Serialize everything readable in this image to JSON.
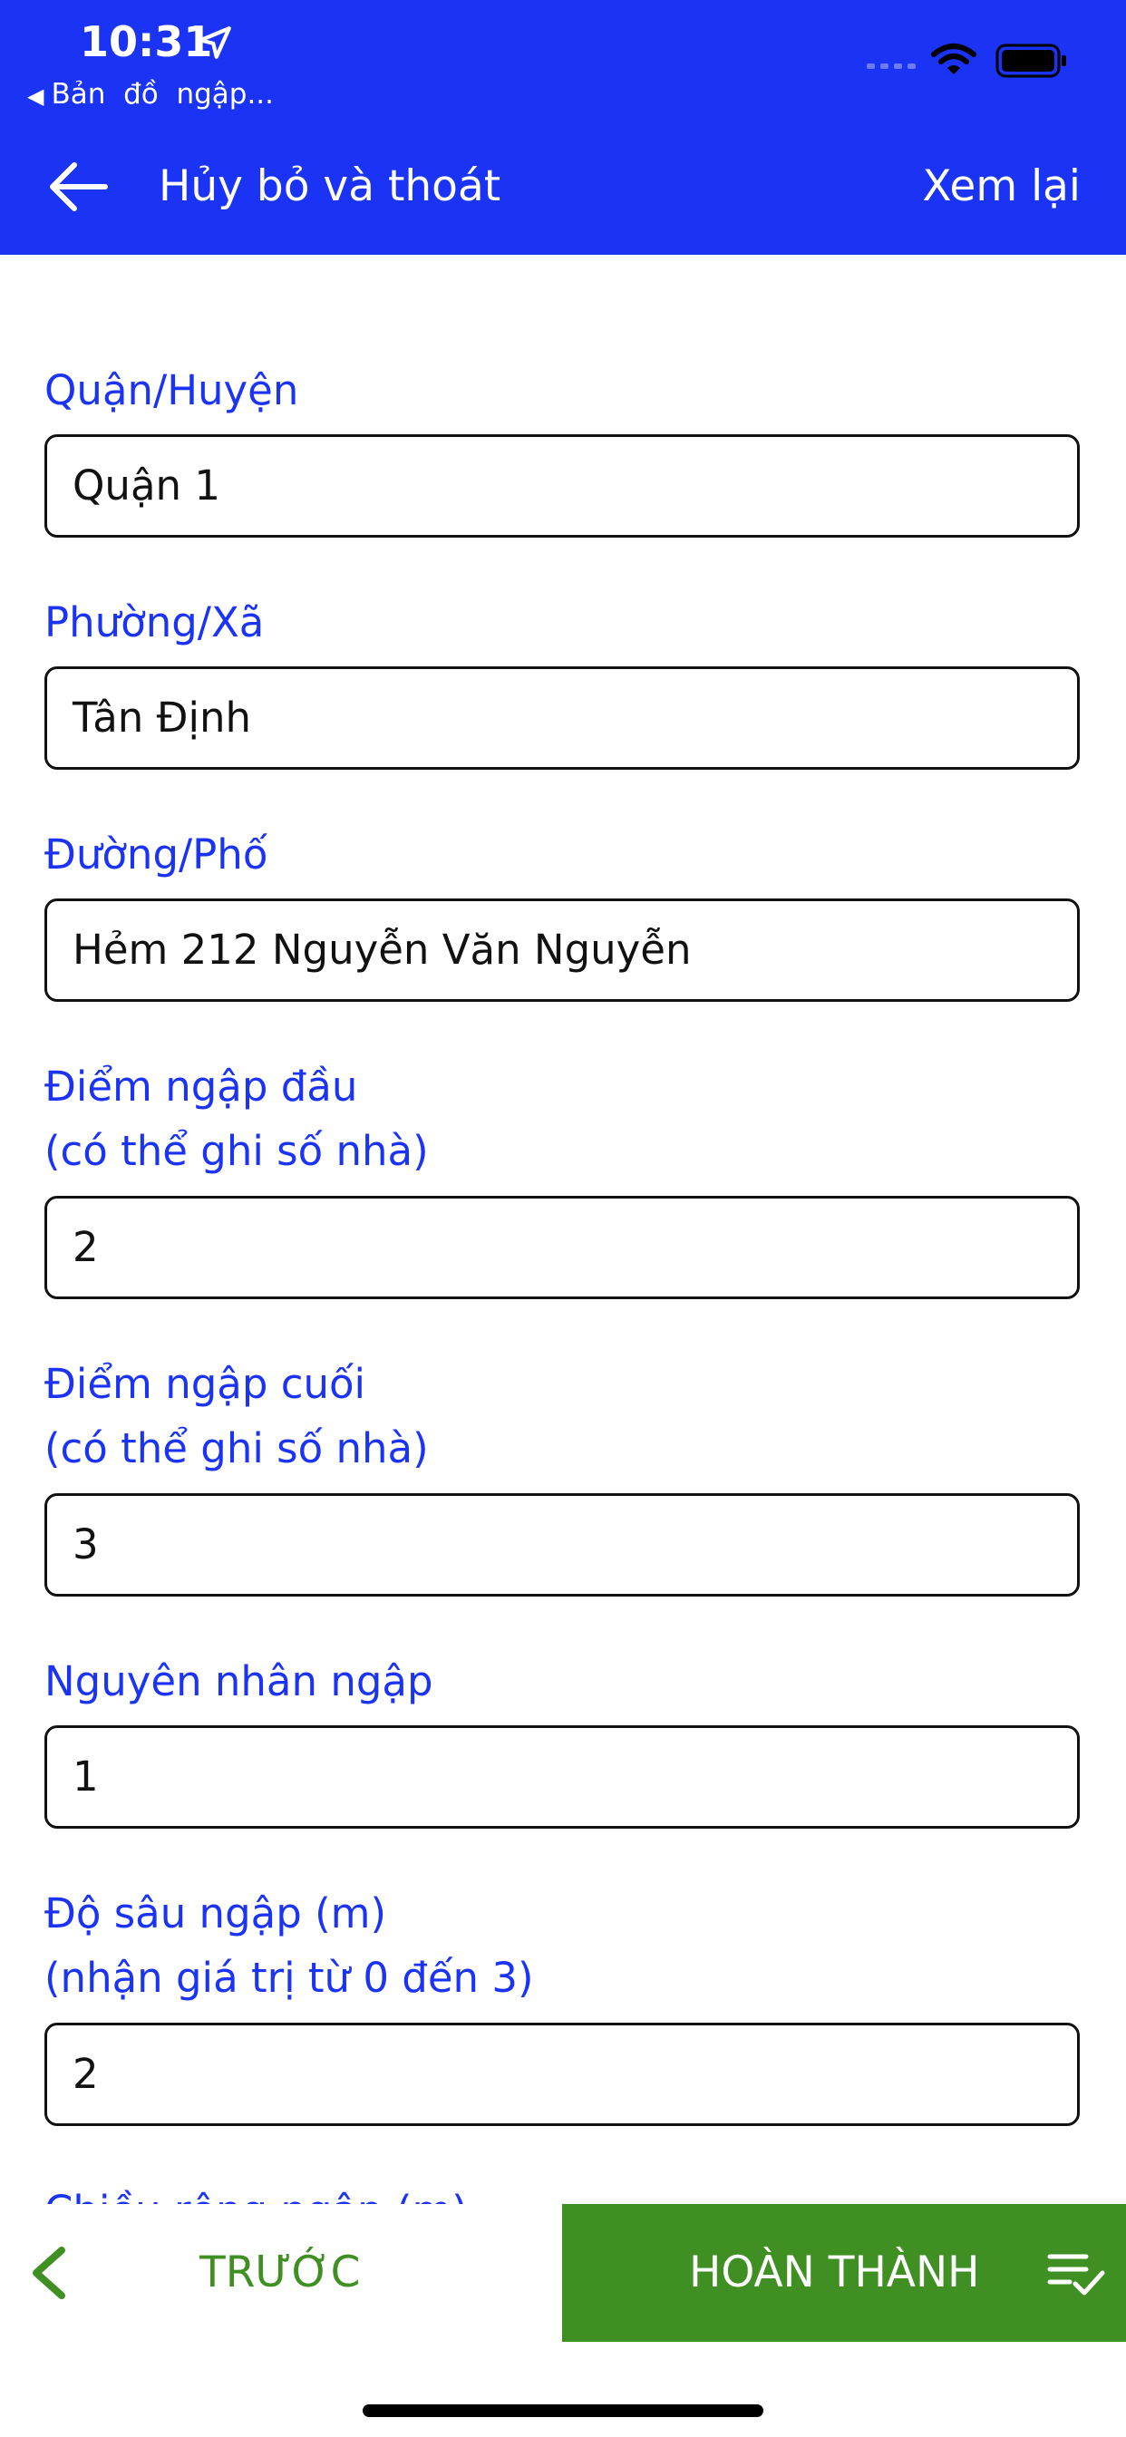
{
  "status_bar": {
    "time": "10:31",
    "back_app": "Bản  đồ  ngập..."
  },
  "nav": {
    "cancel_label": "Hủy bỏ và thoát",
    "review_label": "Xem lại"
  },
  "form": {
    "fields": [
      {
        "label": "Quận/Huyện",
        "value": "Quận 1"
      },
      {
        "label": "Phường/Xã",
        "value": "Tân Định"
      },
      {
        "label": "Đường/Phố",
        "value": "Hẻm 212 Nguyễn Văn Nguyễn"
      },
      {
        "label": "Điểm ngập đầu",
        "sublabel": "(có thể ghi số nhà)",
        "value": "2"
      },
      {
        "label": "Điểm ngập cuối",
        "sublabel": "(có thể ghi số nhà)",
        "value": "3"
      },
      {
        "label": "Nguyên nhân ngập",
        "value": "1"
      },
      {
        "label": "Độ sâu ngập (m)",
        "sublabel": "(nhận giá trị từ 0 đến 3)",
        "value": "2"
      },
      {
        "label": "Chiều rộng ngập (m)"
      }
    ]
  },
  "footer": {
    "prev_label": "TRƯỚC",
    "done_label": "HOÀN THÀNH"
  },
  "colors": {
    "header_bg": "#1b33f5",
    "label_blue": "#1b33f5",
    "accent_green": "#3f8f23"
  },
  "icons": {
    "location": "location-arrow-icon",
    "back": "arrow-left-icon",
    "prev": "chevron-left-icon",
    "done": "checklist-icon",
    "wifi": "wifi-icon",
    "battery": "battery-icon",
    "signal": "cellular-signal-icon"
  }
}
